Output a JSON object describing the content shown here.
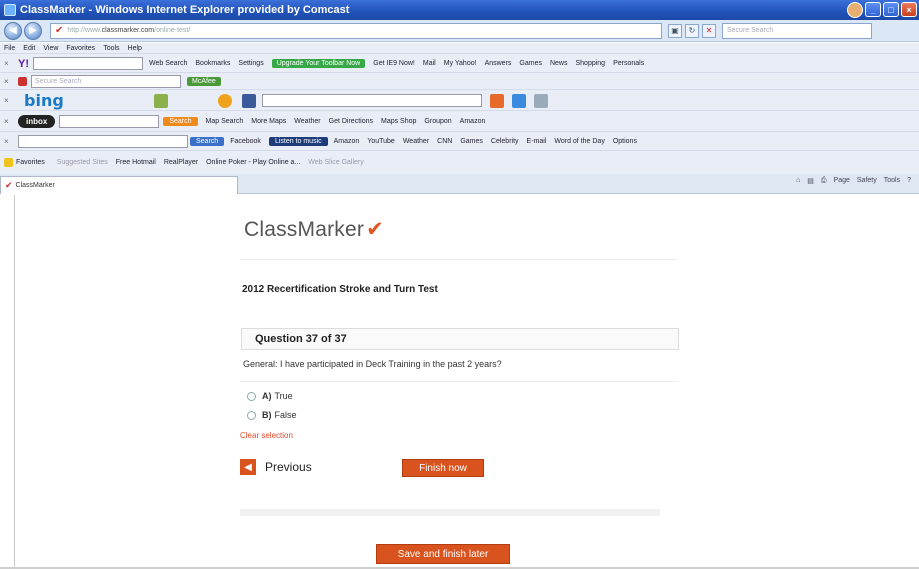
{
  "window": {
    "title": "ClassMarker - Windows Internet Explorer provided by Comcast"
  },
  "address_bar": {
    "url_prefix": "http://www.",
    "url_domain": "classmarker.com",
    "url_path": "/online-test/",
    "live_search_placeholder": "Secure Search"
  },
  "menu": [
    "File",
    "Edit",
    "View",
    "Favorites",
    "Tools",
    "Help"
  ],
  "toolbar_yahoo": {
    "web_search": "Web Search",
    "bookmarks": "Bookmarks",
    "settings": "Settings",
    "upgrade": "Upgrade Your Toolbar Now",
    "get": "Get IE9 Now!",
    "mail": "Mail",
    "my_yahoo": "My Yahoo!",
    "answers": "Answers",
    "games": "Games",
    "news": "News",
    "shopping": "Shopping",
    "personals": "Personals"
  },
  "toolbar_mcafee": {
    "search_placeholder": "Secure Search",
    "mcafee": "McAfee"
  },
  "toolbar_bing": {
    "brand": "bing"
  },
  "toolbar_inbox": {
    "inbox": "inbox",
    "search": "Search",
    "map_search": "Map Search",
    "more_maps": "More Maps",
    "weather": "Weather",
    "get_directions": "Get Directions",
    "maps_shop": "Maps Shop",
    "groupon": "Groupon",
    "amazon": "Amazon"
  },
  "toolbar_search": {
    "search_btn": "Search",
    "facebook": "Facebook",
    "listen": "Listen to music",
    "amazon": "Amazon",
    "youtube": "YouTube",
    "weather": "Weather",
    "cnn": "CNN",
    "games": "Games",
    "celebrity": "Celebrity",
    "email": "E-mail",
    "word_of_day": "Word of the Day",
    "options": "Options"
  },
  "favorites_bar": {
    "favorites": "Favorites",
    "suggested": "Suggested Sites",
    "hotmail": "Free Hotmail",
    "realplayer": "RealPlayer",
    "poker": "Online Poker - Play Online a...",
    "web_slice": "Web Slice Gallery"
  },
  "tab": {
    "label": "ClassMarker"
  },
  "command_bar": [
    "Page",
    "Safety",
    "Tools"
  ],
  "page": {
    "logo": "ClassMarker",
    "logo_tick": "✔",
    "test_title": "2012 Recertification Stroke and Turn Test",
    "question_header": "Question 37 of 37",
    "question_text": "General: I have participated in Deck Training in the past 2 years?",
    "options": [
      {
        "letter": "A)",
        "label": "True"
      },
      {
        "letter": "B)",
        "label": "False"
      }
    ],
    "clear_selection": "Clear selection",
    "previous_label": "Previous",
    "finish_label": "Finish now",
    "save_label": "Save and finish later"
  },
  "colors": {
    "accent": "#d9531e",
    "link_red": "#e04a2a",
    "title_blue": "#2052b8"
  }
}
